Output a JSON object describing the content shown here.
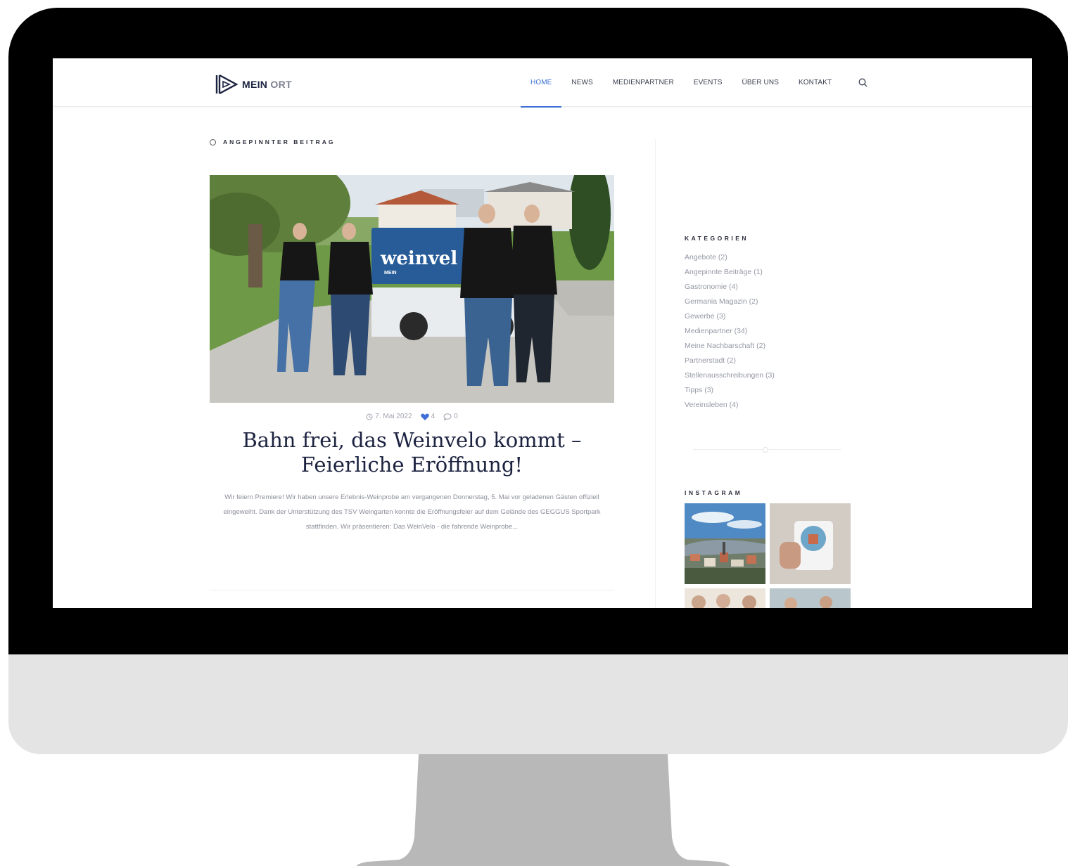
{
  "site": {
    "logo_bold": "MEIN",
    "logo_light": "ORT"
  },
  "nav": {
    "items": [
      {
        "label": "HOME",
        "active": true
      },
      {
        "label": "NEWS",
        "active": false
      },
      {
        "label": "MEDIENPARTNER",
        "active": false
      },
      {
        "label": "EVENTS",
        "active": false
      },
      {
        "label": "ÜBER UNS",
        "active": false
      },
      {
        "label": "KONTAKT",
        "active": false
      }
    ],
    "search_icon": "search-icon"
  },
  "post": {
    "pinned_label": "ANGEPINNTER BEITRAG",
    "banner_text": "weinvel",
    "banner_sub": "MEIN",
    "date": "7. Mai 2022",
    "likes": "4",
    "comments": "0",
    "title_line1": "Bahn frei, das Weinvelo kommt –",
    "title_line2": "Feierliche Eröffnung!",
    "excerpt": "Wir feiern Premiere! Wir haben unsere Erlebnis-Weinprobe am vergangenen Donnerstag, 5. Mai vor geladenen Gästen offiziell eingeweiht. Dank der Unterstützung des TSV Weingarten konnte die Eröffnungsfeier auf dem Gelände des GEGGUS Sportpark stattfinden. Wir präsentieren: Das WeinVelo - die fahrende Weinprobe..."
  },
  "sidebar": {
    "categories_title": "KATEGORIEN",
    "categories": [
      "Angebote (2)",
      "Angepinnte Beiträge (1)",
      "Gastronomie (4)",
      "Germania Magazin (2)",
      "Gewerbe (3)",
      "Medienpartner (34)",
      "Meine Nachbarschaft (2)",
      "Partnerstadt (2)",
      "Stellenausschreibungen (3)",
      "Tipps (3)",
      "Vereinsleben (4)"
    ],
    "instagram_title": "INSTAGRAM"
  },
  "colors": {
    "accent": "#3d6fd6",
    "title": "#1c2340",
    "muted": "#8b8f9b",
    "bezel": "#000000",
    "chin": "#e4e4e4",
    "stand": "#b8b8b8"
  }
}
